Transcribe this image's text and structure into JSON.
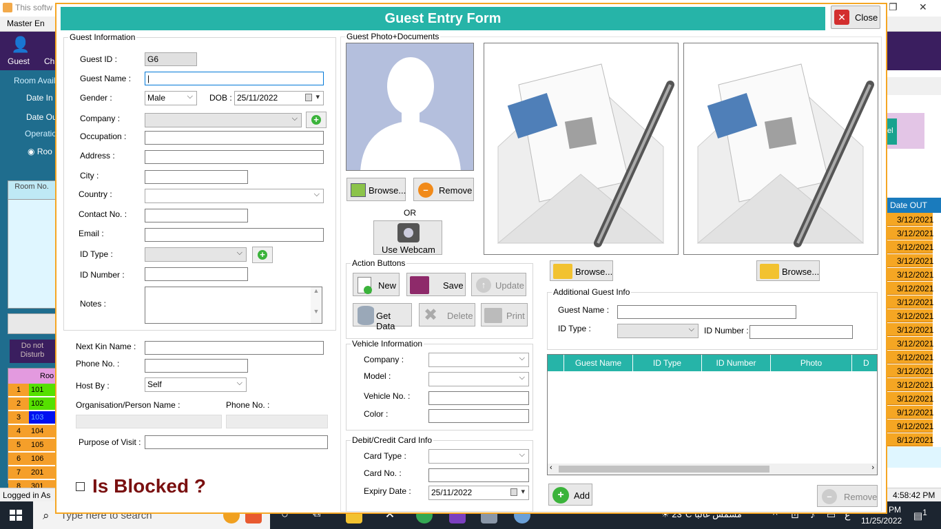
{
  "bg": {
    "title": "This softw",
    "menu": "Master En",
    "toolbar": [
      "Guest",
      "Ch"
    ],
    "left_labels": [
      "Room Availa",
      "Date In :",
      "Date Ou",
      "Operatio",
      "Roo"
    ],
    "grid_head": "Room No.",
    "dnd": "Do not Disturb",
    "room_head": "Roo",
    "rooms": [
      {
        "n": "1",
        "r": "101",
        "color": "#55e000"
      },
      {
        "n": "2",
        "r": "102",
        "color": "#55e000"
      },
      {
        "n": "3",
        "r": "103",
        "color": "#0010f0"
      },
      {
        "n": "4",
        "r": "104",
        "color": "#f59f2a"
      },
      {
        "n": "5",
        "r": "105",
        "color": "#f59f2a"
      },
      {
        "n": "6",
        "r": "106",
        "color": "#f59f2a"
      },
      {
        "n": "7",
        "r": "201",
        "color": "#f59f2a"
      },
      {
        "n": "8",
        "r": "301",
        "color": "#f59f2a"
      }
    ],
    "status_left": "Logged in As",
    "status_right": "4:58:42 PM",
    "right_head": "Date OUT",
    "right_teal": "el",
    "dates_out": [
      "3/12/2021",
      "3/12/2021",
      "3/12/2021",
      "3/12/2021",
      "3/12/2021",
      "3/12/2021",
      "3/12/2021",
      "3/12/2021",
      "3/12/2021",
      "3/12/2021",
      "3/12/2021",
      "3/12/2021",
      "3/12/2021",
      "3/12/2021",
      "9/12/2021",
      "9/12/2021",
      "8/12/2021"
    ]
  },
  "taskbar": {
    "search_placeholder": "Type here to search",
    "weather": "23°C  مشمس غالبًا",
    "time": "PM",
    "date": "11/25/2022",
    "lang": "ع",
    "notif": "1"
  },
  "dialog": {
    "title": "Guest Entry Form",
    "close_label": "Close",
    "guest_info": {
      "legend": "Guest Information",
      "guest_id_label": "Guest ID :",
      "guest_id_value": "G6",
      "guest_name_label": "Guest Name :",
      "guest_name_value": "|",
      "gender_label": "Gender :",
      "gender_value": "Male",
      "dob_label": "DOB :",
      "dob_value": "25/11/2022",
      "company_label": "Company :",
      "occupation_label": "Occupation :",
      "address_label": "Address :",
      "city_label": "City :",
      "country_label": "Country :",
      "contact_label": "Contact No. :",
      "email_label": "Email :",
      "idtype_label": "ID Type :",
      "idnumber_label": "ID Number :",
      "notes_label": "Notes :"
    },
    "kin": {
      "kin_name_label": "Next Kin Name :",
      "phone_label": "Phone No. :",
      "host_label": "Host By :",
      "host_value": "Self",
      "org_label": "Organisation/Person Name :",
      "org_phone_label": "Phone No. :",
      "purpose_label": "Purpose of Visit :"
    },
    "blocked_label": "Is Blocked ?",
    "photo": {
      "legend": "Guest Photo+Documents",
      "browse_label": "Browse...",
      "remove_label": "Remove",
      "or_label": "OR",
      "webcam_label": "Use Webcam",
      "doc_browse_label": "Browse..."
    },
    "actions": {
      "legend": "Action Buttons",
      "new_label": "New",
      "save_label": "Save",
      "update_label": "Update",
      "getdata_label": "Get Data",
      "delete_label": "Delete",
      "print_label": "Print"
    },
    "vehicle": {
      "legend": "Vehicle Information",
      "company_label": "Company :",
      "model_label": "Model :",
      "vehicle_no_label": "Vehicle No. :",
      "color_label": "Color :"
    },
    "card": {
      "legend": "Debit/Credit Card Info",
      "card_type_label": "Card Type :",
      "card_no_label": "Card No. :",
      "expiry_label": "Expiry Date :",
      "expiry_value": "25/11/2022"
    },
    "additional": {
      "legend": "Additional Guest Info",
      "guest_name_label": "Guest Name :",
      "idtype_label": "ID Type :",
      "idnumber_label": "ID Number :",
      "columns": [
        "Guest Name",
        "ID Type",
        "ID Number",
        "Photo",
        "D"
      ],
      "add_label": "Add",
      "remove_label": "Remove"
    },
    "colors": {
      "header": "#26b4a8",
      "border": "#f5a623",
      "blocked": "#7a1010"
    }
  }
}
